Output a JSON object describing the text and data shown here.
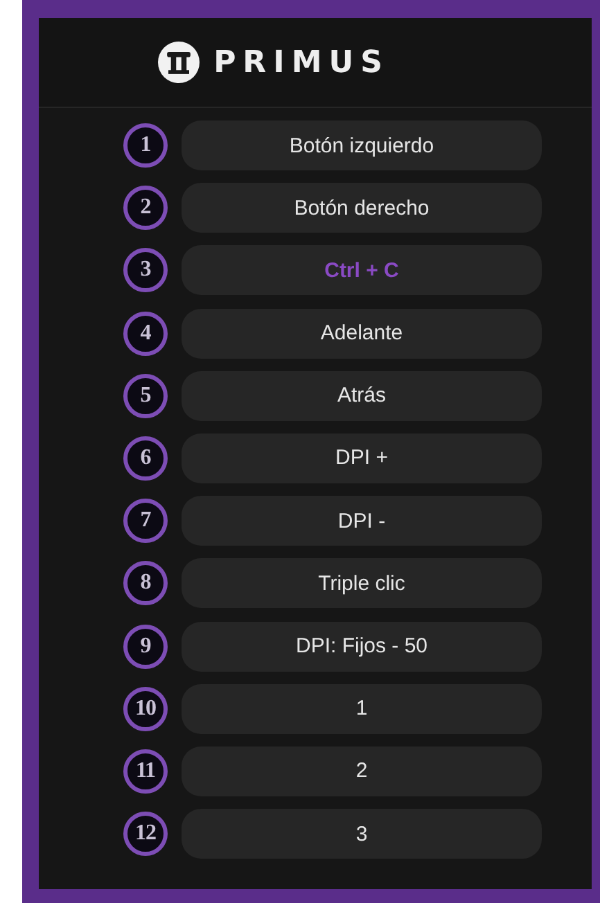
{
  "header": {
    "brand": "PRIMUS"
  },
  "buttons": [
    {
      "number": "1",
      "action": "Botón izquierdo",
      "selected": false
    },
    {
      "number": "2",
      "action": "Botón derecho",
      "selected": false
    },
    {
      "number": "3",
      "action": "Ctrl + C",
      "selected": true
    },
    {
      "number": "4",
      "action": "Adelante",
      "selected": false
    },
    {
      "number": "5",
      "action": "Atrás",
      "selected": false
    },
    {
      "number": "6",
      "action": "DPI +",
      "selected": false
    },
    {
      "number": "7",
      "action": "DPI -",
      "selected": false
    },
    {
      "number": "8",
      "action": "Triple clic",
      "selected": false
    },
    {
      "number": "9",
      "action": "DPI: Fijos - 50",
      "selected": false
    },
    {
      "number": "10",
      "action": "1",
      "selected": false
    },
    {
      "number": "11",
      "action": "2",
      "selected": false
    },
    {
      "number": "12",
      "action": "3",
      "selected": false
    }
  ]
}
